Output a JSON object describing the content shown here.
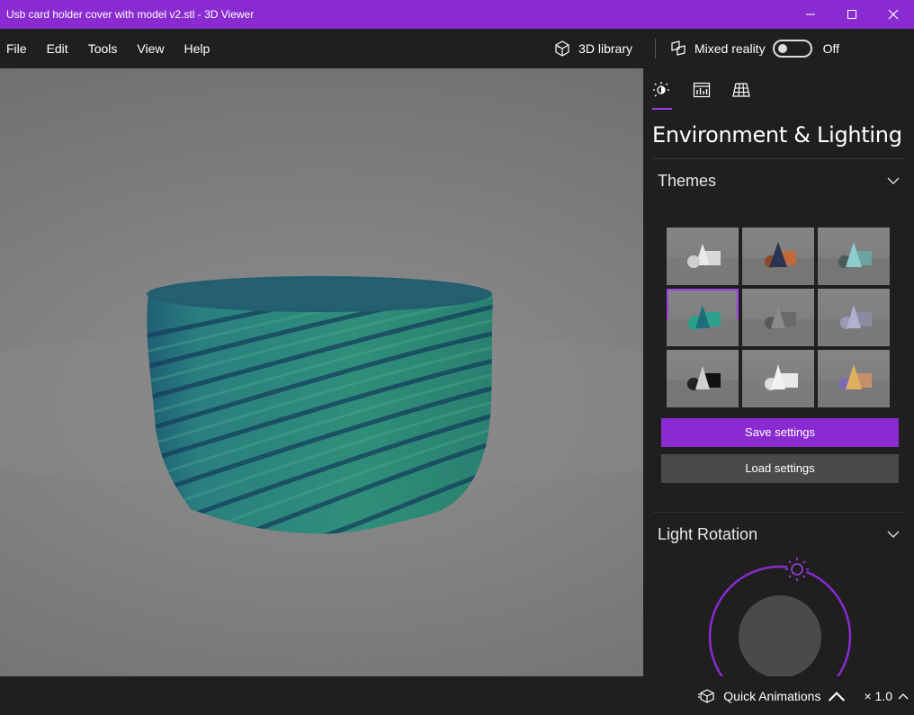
{
  "window": {
    "title": "Usb card holder cover with model v2.stl - 3D Viewer"
  },
  "menu": {
    "items": [
      "File",
      "Edit",
      "Tools",
      "View",
      "Help"
    ],
    "library_label": "3D library",
    "mixed_reality_label": "Mixed reality",
    "mixed_reality_state": "Off"
  },
  "viewport": {
    "model_color": "#2c8e7c",
    "background_color": "#808080"
  },
  "panel": {
    "tabs": [
      "lighting-icon",
      "stats-icon",
      "grid-icon"
    ],
    "heading": "Environment & Lighting",
    "themes_label": "Themes",
    "selected_theme_index": 3,
    "save_label": "Save settings",
    "load_label": "Load settings",
    "light_rotation_label": "Light Rotation",
    "accent_color": "#8a2bd2"
  },
  "status": {
    "quick_animations_label": "Quick Animations",
    "speed_label": "× 1.0"
  }
}
